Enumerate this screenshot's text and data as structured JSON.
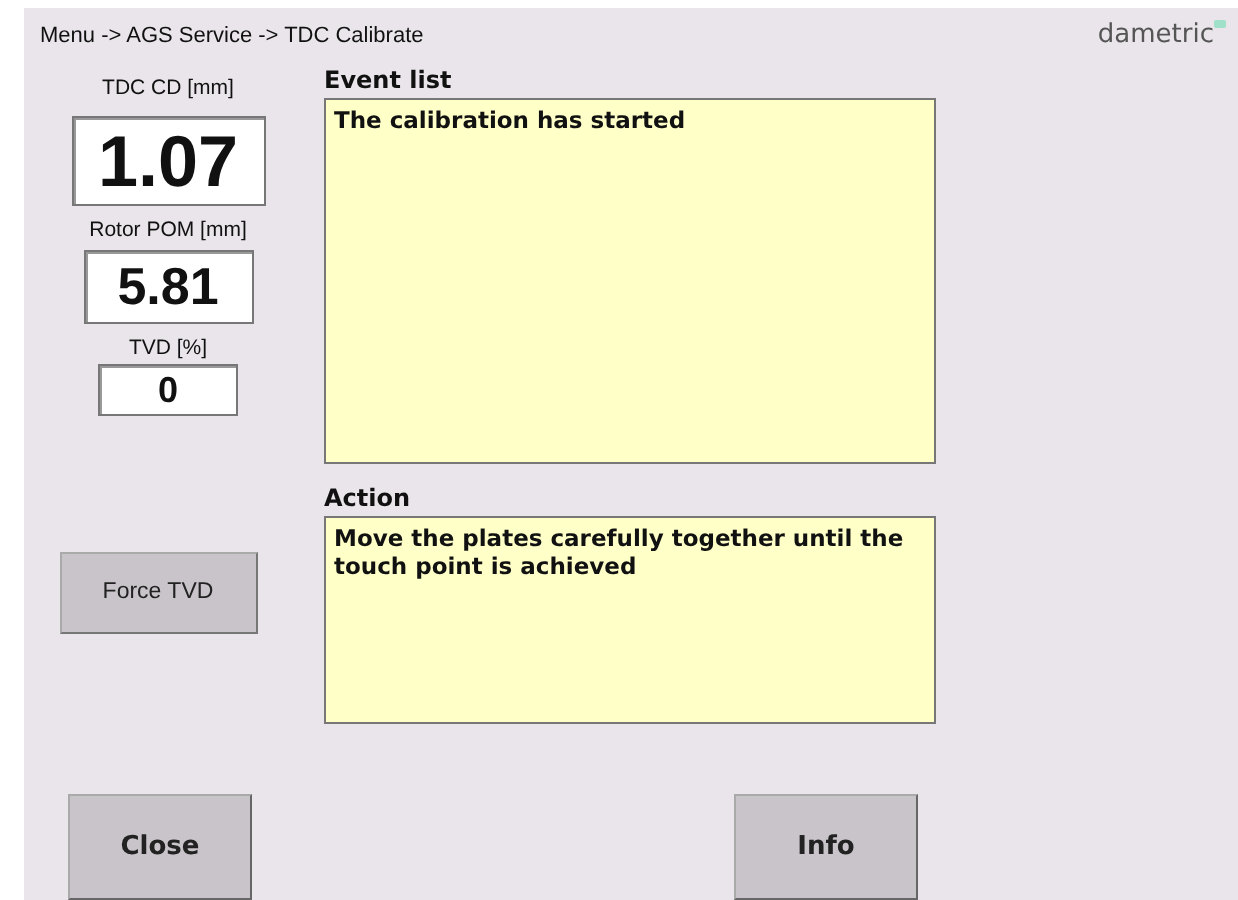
{
  "breadcrumb": "Menu -> AGS Service -> TDC  Calibrate",
  "logo": "dametric",
  "readouts": [
    {
      "label": "TDC CD [mm]",
      "value": "1.07"
    },
    {
      "label": "Rotor POM [mm]",
      "value": "5.81"
    },
    {
      "label": "TVD [%]",
      "value": "0"
    }
  ],
  "event_list": {
    "label": "Event list",
    "text": "The calibration has started"
  },
  "action": {
    "label": "Action",
    "text": "Move the plates carefully together until the touch point is achieved"
  },
  "side_button": "Force TVD",
  "buttons": [
    "Close",
    "Info"
  ]
}
